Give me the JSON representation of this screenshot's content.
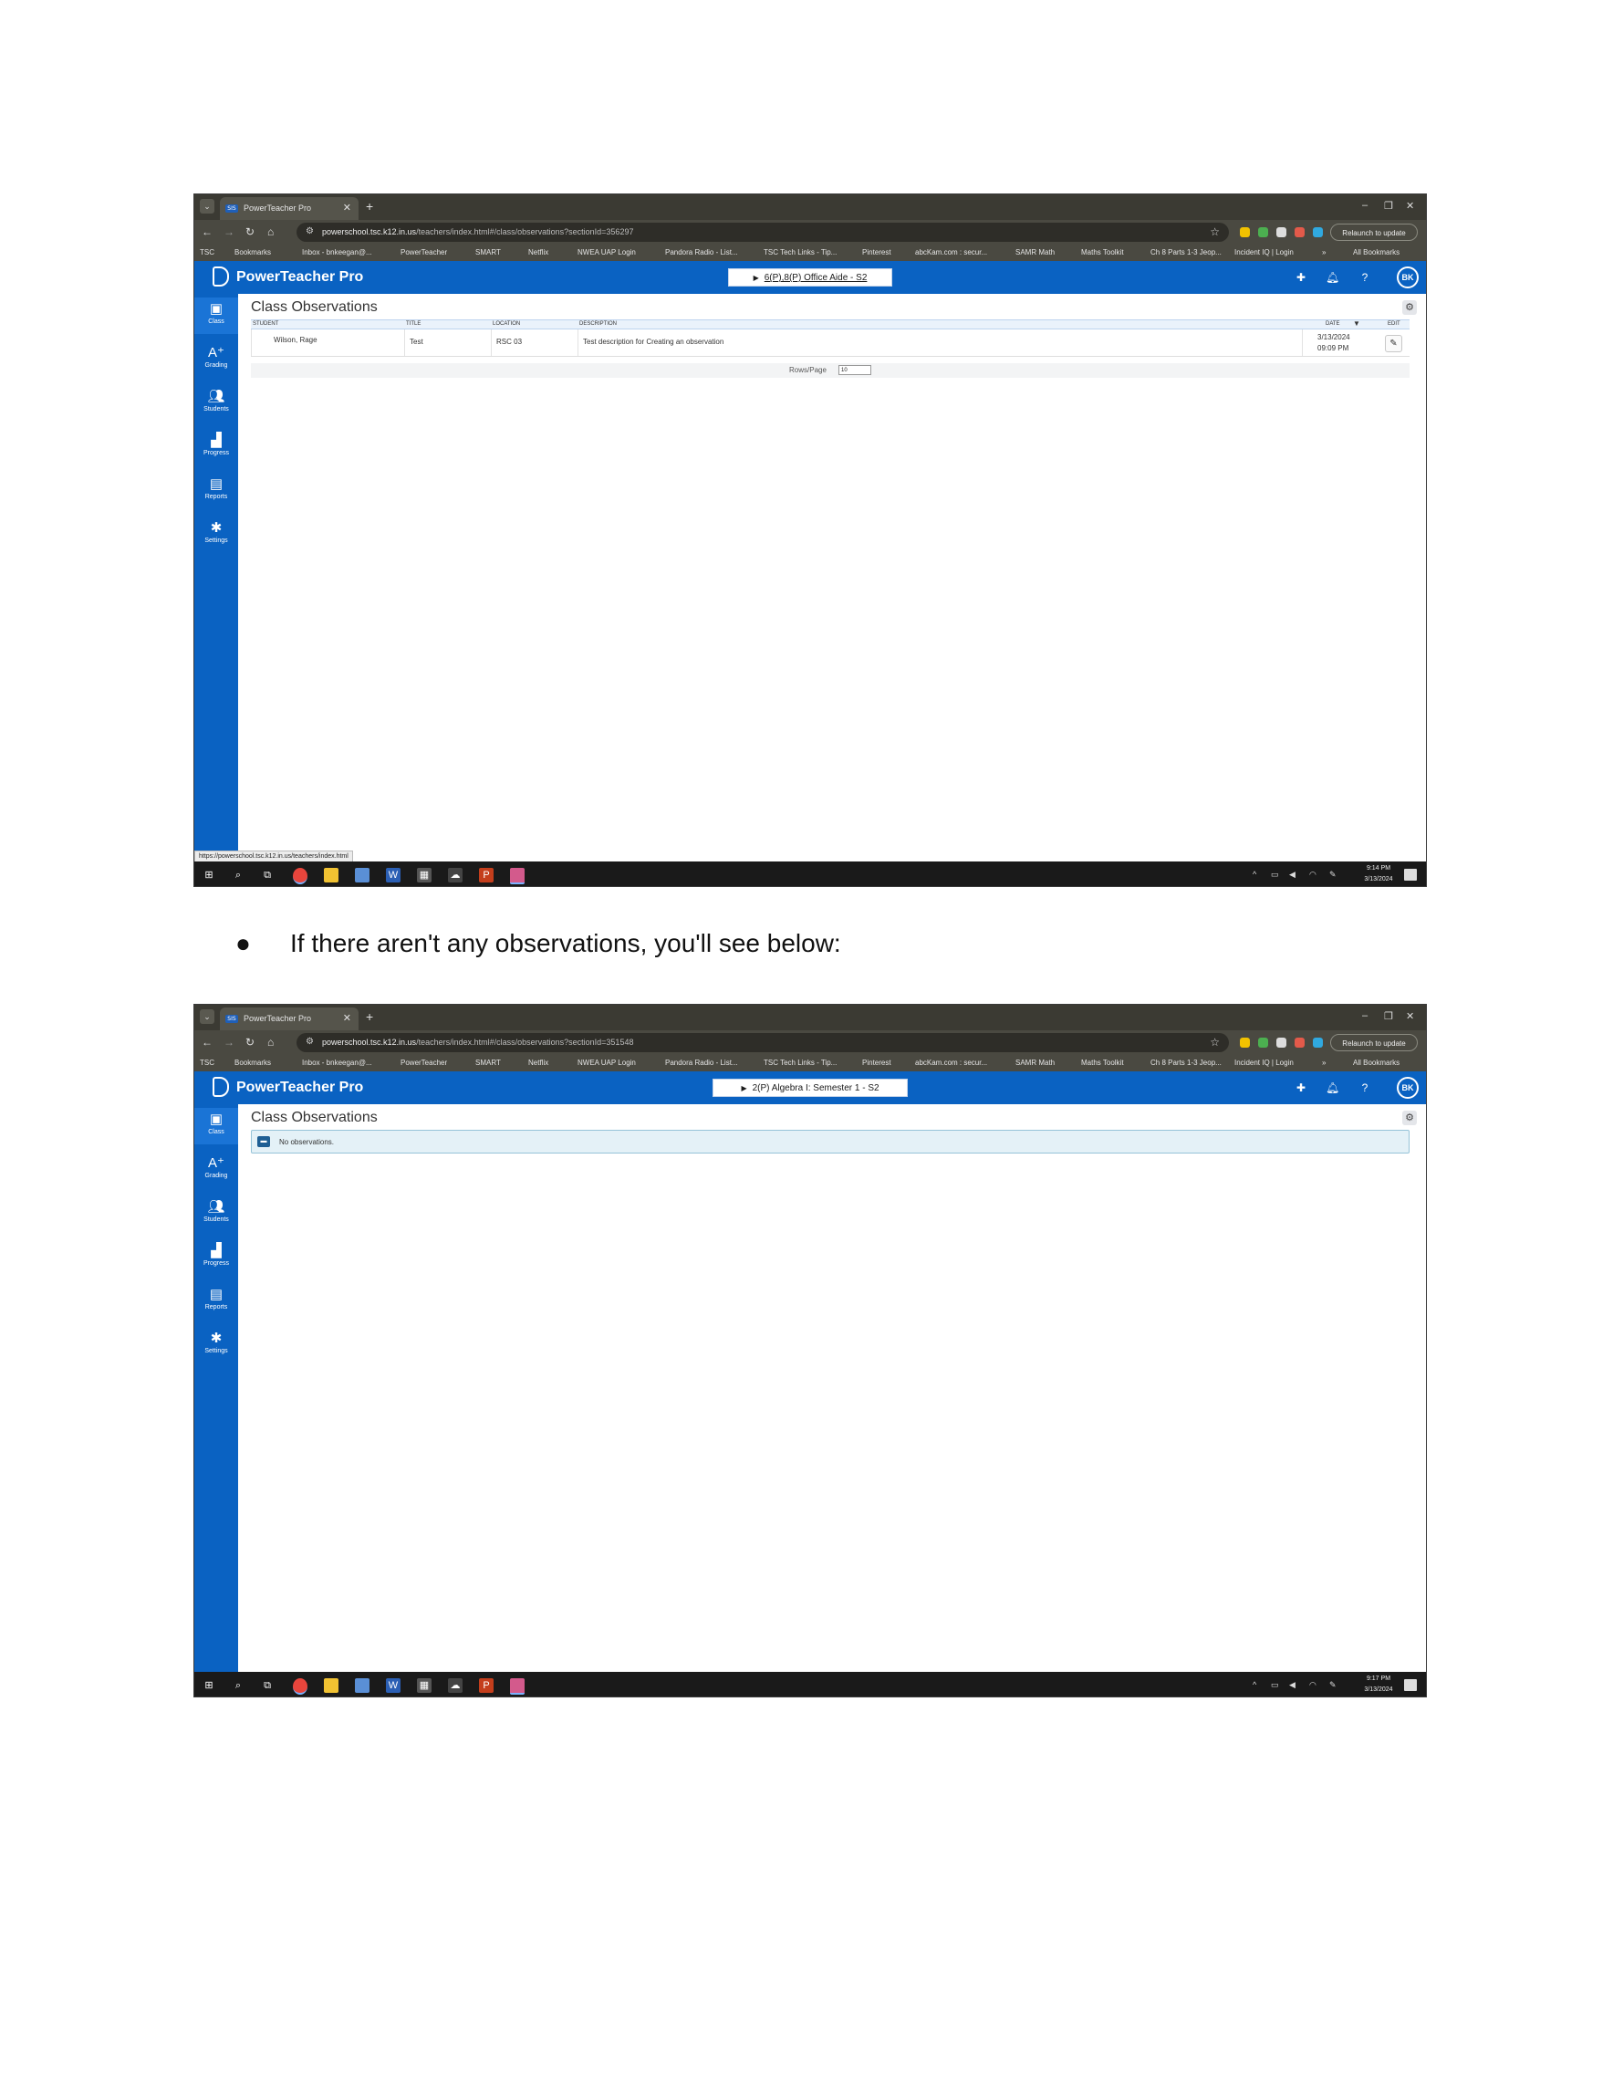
{
  "screens": [
    {
      "browser": {
        "tab_title": "PowerTeacher Pro",
        "tab_favicon": "SIS",
        "url_host": "powerschool.tsc.k12.in.us",
        "url_path": "/teachers/index.html#/class/observations?sectionId=356297",
        "relaunch_label": "Relaunch to update"
      },
      "bookmarks": [
        "TSC",
        "Bookmarks",
        "Inbox - bnkeegan@...",
        "PowerTeacher",
        "SMART",
        "Netflix",
        "NWEA UAP Login",
        "Pandora Radio - List...",
        "TSC Tech Links - Tip...",
        "Pinterest",
        "abcKam.com : secur...",
        "SAMR Math",
        "Maths Toolkit",
        "Ch 8 Parts 1-3 Jeop...",
        "Incident IQ | Login",
        "»",
        "All Bookmarks"
      ],
      "app": {
        "title": "PowerTeacher Pro",
        "section": "6(P),8(P) Office Aide - S2",
        "avatar": "BK"
      },
      "sidebar": [
        "Class",
        "Grading",
        "Students",
        "Progress",
        "Reports",
        "Settings"
      ],
      "page_title": "Class Observations",
      "table": {
        "headers": {
          "student": "STUDENT",
          "title": "TITLE",
          "location": "LOCATION",
          "description": "DESCRIPTION",
          "date": "DATE",
          "edit": "EDIT"
        },
        "rows": [
          {
            "student": "Wilson, Rage",
            "title": "Test",
            "location": "RSC 03",
            "description": "Test description for Creating an observation",
            "date": "3/13/2024",
            "time": "09:09 PM"
          }
        ]
      },
      "rows_per_page": {
        "label": "Rows/Page",
        "value": "10"
      },
      "status_url": "https://powerschool.tsc.k12.in.us/teachers/index.html",
      "taskbar": {
        "time": "9:14 PM",
        "date": "3/13/2024"
      }
    },
    {
      "browser": {
        "tab_title": "PowerTeacher Pro",
        "tab_favicon": "SIS",
        "url_host": "powerschool.tsc.k12.in.us",
        "url_path": "/teachers/index.html#/class/observations?sectionId=351548",
        "relaunch_label": "Relaunch to update"
      },
      "bookmarks": [
        "TSC",
        "Bookmarks",
        "Inbox - bnkeegan@...",
        "PowerTeacher",
        "SMART",
        "Netflix",
        "NWEA UAP Login",
        "Pandora Radio - List...",
        "TSC Tech Links - Tip...",
        "Pinterest",
        "abcKam.com : secur...",
        "SAMR Math",
        "Maths Toolkit",
        "Ch 8 Parts 1-3 Jeop...",
        "Incident IQ | Login",
        "»",
        "All Bookmarks"
      ],
      "app": {
        "title": "PowerTeacher Pro",
        "section": "2(P) Algebra I: Semester 1 - S2",
        "avatar": "BK"
      },
      "sidebar": [
        "Class",
        "Grading",
        "Students",
        "Progress",
        "Reports",
        "Settings"
      ],
      "page_title": "Class Observations",
      "empty_message": "No observations.",
      "taskbar": {
        "time": "9:17 PM",
        "date": "3/13/2024"
      }
    }
  ],
  "doc_bullet": "If there aren't any observations, you'll see below:"
}
